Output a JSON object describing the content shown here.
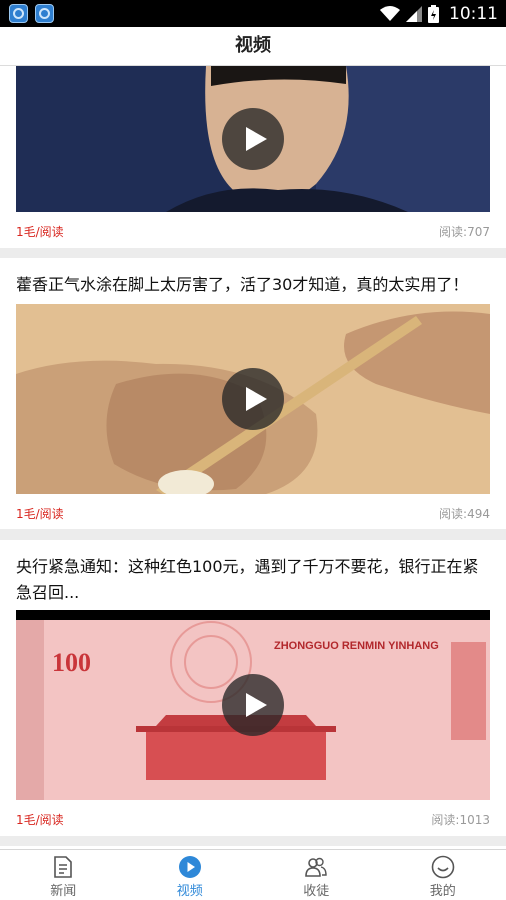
{
  "status_bar": {
    "time": "10:11"
  },
  "header": {
    "title": "视频"
  },
  "feed": {
    "items": [
      {
        "title": "",
        "reward": "1毛/阅读",
        "reads": "阅读:707"
      },
      {
        "title": "藿香正气水涂在脚上太厉害了，活了30才知道，真的太实用了！",
        "reward": "1毛/阅读",
        "reads": "阅读:494"
      },
      {
        "title": "央行紧急通知：这种红色100元，遇到了千万不要花，银行正在紧急召回...",
        "reward": "1毛/阅读",
        "reads": "阅读:1013",
        "banknote_text": "ZHONGGUO RENMIN YINHANG",
        "banknote_value": "100"
      }
    ]
  },
  "tabs": [
    {
      "label": "新闻",
      "icon": "document-icon"
    },
    {
      "label": "视频",
      "icon": "play-circle-icon",
      "active": true
    },
    {
      "label": "收徒",
      "icon": "people-icon"
    },
    {
      "label": "我的",
      "icon": "smiley-icon"
    }
  ],
  "colors": {
    "accent": "#2e88d8",
    "reward": "#d8261f",
    "reads": "#9a9a9a"
  }
}
